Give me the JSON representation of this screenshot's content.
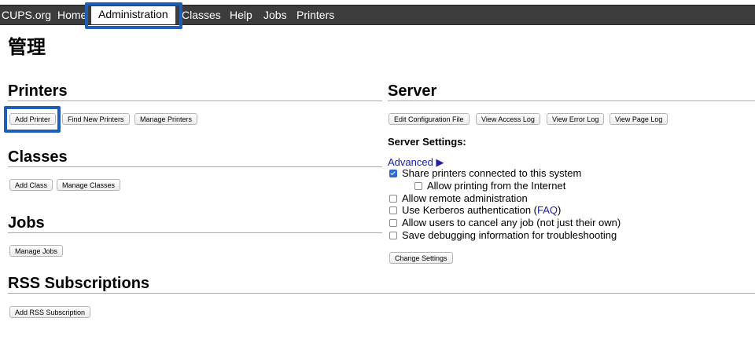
{
  "nav": {
    "items": [
      {
        "label": "CUPS.org"
      },
      {
        "label": "Home"
      },
      {
        "label": "Administration"
      },
      {
        "label": "Classes"
      },
      {
        "label": "Help"
      },
      {
        "label": "Jobs"
      },
      {
        "label": "Printers"
      }
    ],
    "active": "Administration"
  },
  "page": {
    "title": "管理"
  },
  "printers": {
    "title": "Printers",
    "buttons": [
      "Add Printer",
      "Find New Printers",
      "Manage Printers"
    ]
  },
  "classes": {
    "title": "Classes",
    "buttons": [
      "Add Class",
      "Manage Classes"
    ]
  },
  "jobs": {
    "title": "Jobs",
    "buttons": [
      "Manage Jobs"
    ]
  },
  "rss": {
    "title": "RSS Subscriptions",
    "buttons": [
      "Add RSS Subscription"
    ]
  },
  "server": {
    "title": "Server",
    "buttons": [
      "Edit Configuration File",
      "View Access Log",
      "View Error Log",
      "View Page Log"
    ],
    "settings_label": "Server Settings:",
    "advanced_label": "Advanced ▶",
    "options": [
      {
        "label": "Share printers connected to this system",
        "checked": true
      },
      {
        "label": "Allow printing from the Internet",
        "checked": false
      },
      {
        "label": "Allow remote administration",
        "checked": false
      },
      {
        "label_before": "Use Kerberos authentication (",
        "link": "FAQ",
        "label_after": ")",
        "checked": false
      },
      {
        "label": "Allow users to cancel any job (not just their own)",
        "checked": false
      },
      {
        "label": "Save debugging information for troubleshooting",
        "checked": false
      }
    ],
    "change_button": "Change Settings"
  },
  "colors": {
    "navbar": "#3c3c3c",
    "highlight": "#1f5fb3",
    "link": "#1a21a8"
  }
}
